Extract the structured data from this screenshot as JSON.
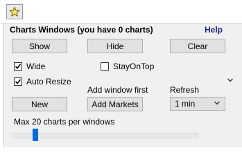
{
  "toolbar": {
    "star_icon": "star-icon"
  },
  "panel": {
    "title": "Charts Windows (you have 0 charts)",
    "help_link": "Help",
    "buttons": {
      "show": "Show",
      "hide": "Hide",
      "clear": "Clear",
      "new": "New",
      "add_markets": "Add Markets"
    },
    "checkboxes": {
      "wide": {
        "label": "Wide",
        "checked": true
      },
      "stay_on_top": {
        "label": "StayOnTop",
        "checked": false
      },
      "auto_resize": {
        "label": "Auto Resize",
        "checked": true
      }
    },
    "add_window_first_text": "Add window first",
    "refresh_label": "Refresh",
    "refresh_value": "1 min",
    "max_charts_text": "Max 20 charts per windows",
    "slider_value": 20
  },
  "colors": {
    "panel_bg": "#f0f0f0",
    "button_bg": "#e1e1e1",
    "help_link": "#1a237e",
    "slider_thumb": "#0b6bd6",
    "star_fill": "#ffe36e"
  }
}
